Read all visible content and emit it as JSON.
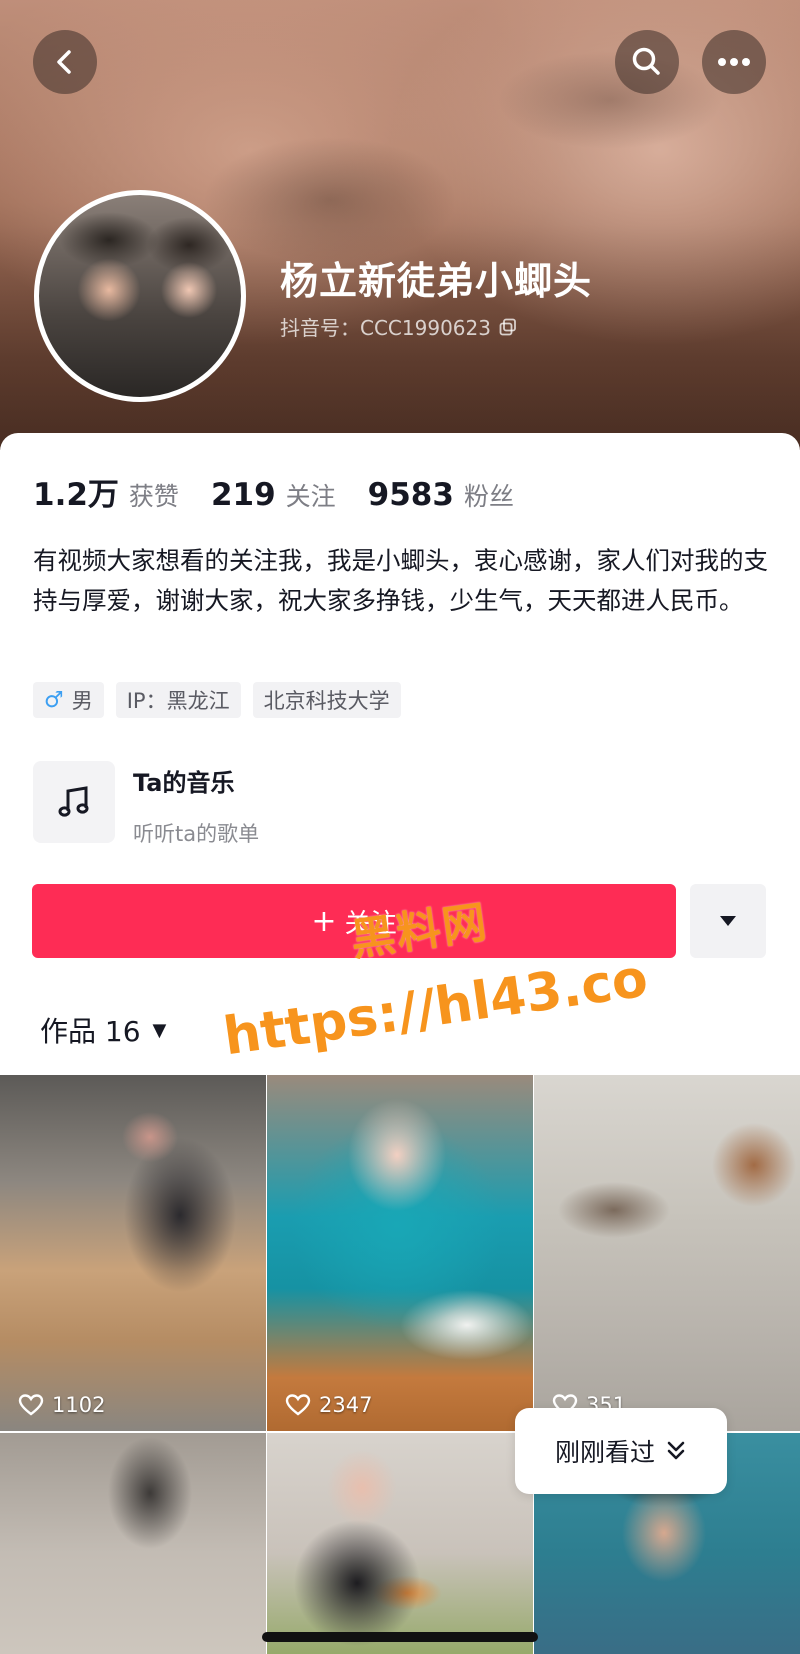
{
  "header": {
    "nickname": "杨立新徒弟小蝍头",
    "douyin_id": "抖音号：CCC1990623"
  },
  "icons": {
    "back": "chevron-left-icon",
    "search": "search-icon",
    "more": "more-dots-icon",
    "copy": "copy-icon",
    "music": "music-note-icon",
    "dropdown": "caret-down-icon",
    "like": "heart-outline-icon",
    "recent": "double-chevron-down-icon"
  },
  "stats": [
    {
      "value": "1.2万",
      "label": "获赞"
    },
    {
      "value": "219",
      "label": "关注"
    },
    {
      "value": "9583",
      "label": "粉丝"
    }
  ],
  "bio": "有视频大家想看的关注我，我是小蝍头，衷心感谢，家人们对我的支持与厚爱，谢谢大家，祝大家多挣钱，少生气，天天都进人民币。",
  "tags": {
    "gender": "男",
    "ip": "IP：黑龙江",
    "school": "北京科技大学"
  },
  "music": {
    "title": "Ta的音乐",
    "subtitle": "听听ta的歌单"
  },
  "actions": {
    "follow_plus": "+",
    "follow_label": "关注"
  },
  "works_tab": {
    "label": "作品 16"
  },
  "watermark": {
    "line1": "黑料网",
    "line2": "https://hl43.co"
  },
  "videos": [
    {
      "likes": "1102"
    },
    {
      "likes": "2347"
    },
    {
      "likes": "351"
    },
    {
      "likes": ""
    },
    {
      "likes": ""
    },
    {
      "likes": ""
    }
  ],
  "recent_pill": {
    "label": "刚刚看过"
  },
  "colors": {
    "accent": "#fe2c55",
    "watermark": "#f7941d",
    "male": "#3c9ff2"
  }
}
